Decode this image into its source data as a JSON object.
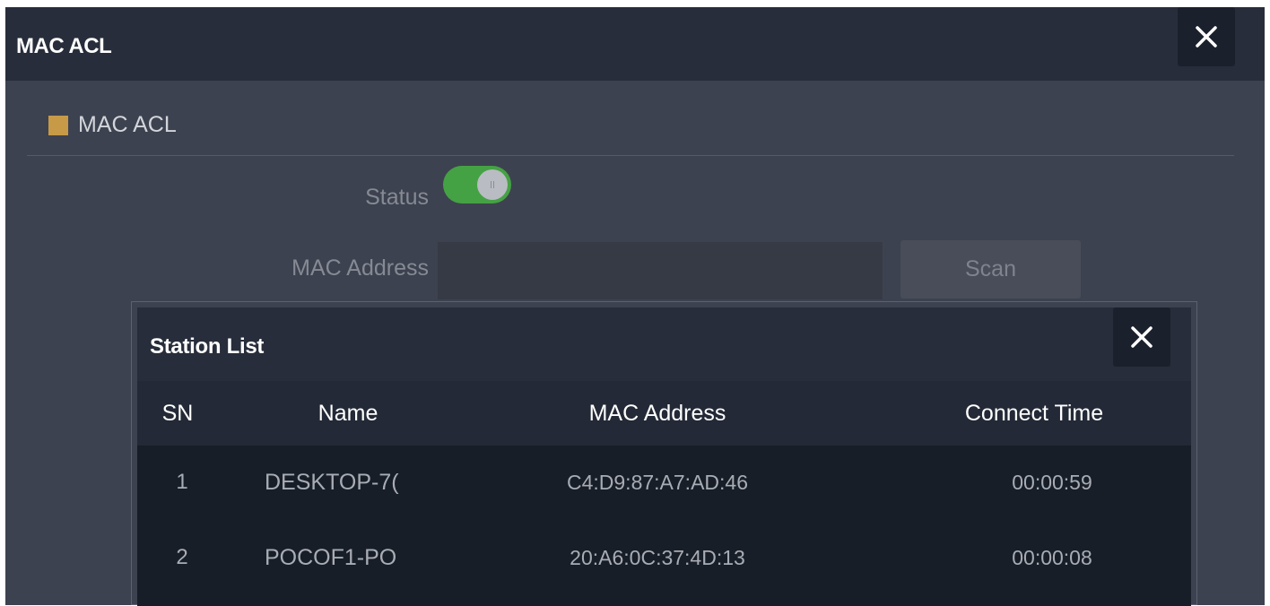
{
  "dialog": {
    "title": "MAC ACL",
    "close_icon": "close-icon",
    "section_title": "MAC ACL",
    "section_color": "#c69a47",
    "status_label": "Status",
    "status_enabled": true,
    "toggle_color": "#45a244",
    "mac_label": "MAC Address",
    "mac_value": "",
    "scan_label": "Scan"
  },
  "station_list": {
    "title": "Station List",
    "close_icon": "close-icon",
    "columns": [
      "SN",
      "Name",
      "MAC Address",
      "Connect Time"
    ],
    "rows": [
      {
        "sn": "1",
        "name": "DESKTOP-7(",
        "mac": "C4:D9:87:A7:AD:46",
        "time": "00:00:59"
      },
      {
        "sn": "2",
        "name": "POCOF1-PO",
        "mac": "20:A6:0C:37:4D:13",
        "time": "00:00:08"
      }
    ]
  }
}
